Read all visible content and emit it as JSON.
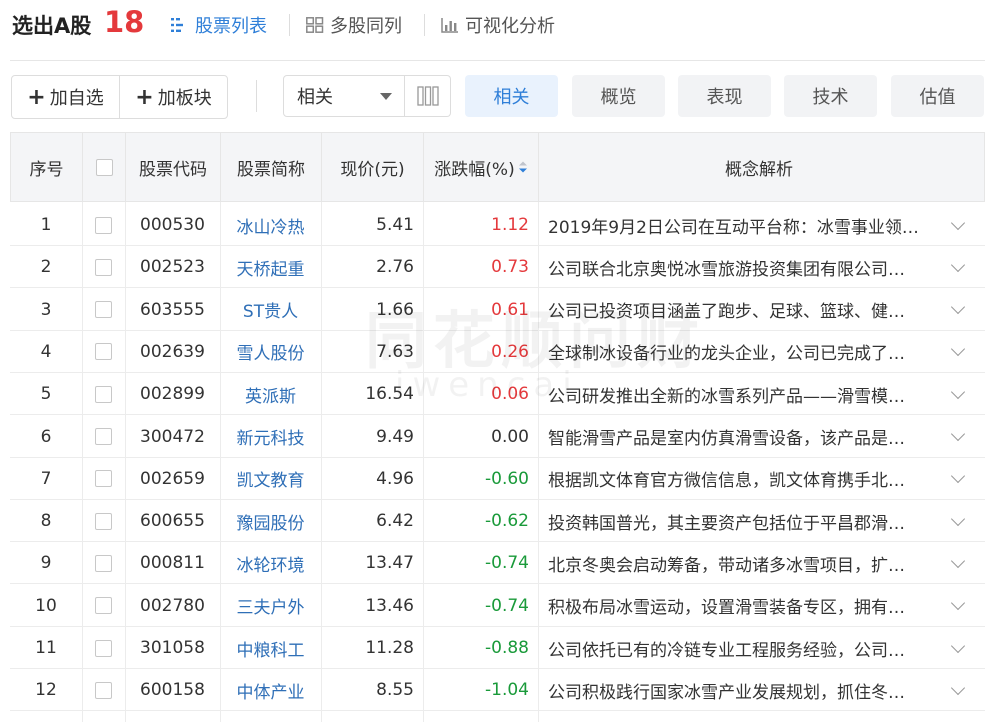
{
  "header": {
    "title": "选出A股",
    "count": "18",
    "tabs": [
      {
        "label": "股票列表",
        "icon": "list-icon",
        "active": true
      },
      {
        "label": "多股同列",
        "icon": "grid-icon",
        "active": false
      },
      {
        "label": "可视化分析",
        "icon": "bar-chart-icon",
        "active": false
      }
    ]
  },
  "toolbar": {
    "add_watchlist": "加自选",
    "add_block": "加板块",
    "sort_select": "相关",
    "filters": [
      "相关",
      "概览",
      "表现",
      "技术",
      "估值"
    ],
    "active_filter": "相关"
  },
  "colors": {
    "accent": "#2f7fd8",
    "up": "#e4393c",
    "down": "#1a9a3a"
  },
  "table": {
    "columns": [
      "序号",
      "股票代码",
      "股票简称",
      "现价(元)",
      "涨跌幅(%)",
      "概念解析"
    ],
    "rows": [
      {
        "no": "1",
        "code": "000530",
        "name": "冰山冷热",
        "price": "5.41",
        "change": "1.12",
        "dir": "up",
        "concept": "2019年9月2日公司在互动平台称：冰雪事业领…"
      },
      {
        "no": "2",
        "code": "002523",
        "name": "天桥起重",
        "price": "2.76",
        "change": "0.73",
        "dir": "up",
        "concept": "公司联合北京奥悦冰雪旅游投资集团有限公司…"
      },
      {
        "no": "3",
        "code": "603555",
        "name": "ST贵人",
        "price": "1.66",
        "change": "0.61",
        "dir": "up",
        "concept": "公司已投资项目涵盖了跑步、足球、篮球、健…"
      },
      {
        "no": "4",
        "code": "002639",
        "name": "雪人股份",
        "price": "7.63",
        "change": "0.26",
        "dir": "up",
        "concept": "全球制冰设备行业的龙头企业，公司已完成了…"
      },
      {
        "no": "5",
        "code": "002899",
        "name": "英派斯",
        "price": "16.54",
        "change": "0.06",
        "dir": "up",
        "concept": "公司研发推出全新的冰雪系列产品——滑雪模…"
      },
      {
        "no": "6",
        "code": "300472",
        "name": "新元科技",
        "price": "9.49",
        "change": "0.00",
        "dir": "flat",
        "concept": "智能滑雪产品是室内仿真滑雪设备，该产品是…"
      },
      {
        "no": "7",
        "code": "002659",
        "name": "凯文教育",
        "price": "4.96",
        "change": "-0.60",
        "dir": "down",
        "concept": "根据凯文体育官方微信信息，凯文体育携手北…"
      },
      {
        "no": "8",
        "code": "600655",
        "name": "豫园股份",
        "price": "6.42",
        "change": "-0.62",
        "dir": "down",
        "concept": "投资韩国普光，其主要资产包括位于平昌郡滑…"
      },
      {
        "no": "9",
        "code": "000811",
        "name": "冰轮环境",
        "price": "13.47",
        "change": "-0.74",
        "dir": "down",
        "concept": "北京冬奥会启动筹备，带动诸多冰雪项目，扩…"
      },
      {
        "no": "10",
        "code": "002780",
        "name": "三夫户外",
        "price": "13.46",
        "change": "-0.74",
        "dir": "down",
        "concept": "积极布局冰雪运动，设置滑雪装备专区，拥有…"
      },
      {
        "no": "11",
        "code": "301058",
        "name": "中粮科工",
        "price": "11.28",
        "change": "-0.88",
        "dir": "down",
        "concept": "公司依托已有的冷链专业工程服务经验，公司…"
      },
      {
        "no": "12",
        "code": "600158",
        "name": "中体产业",
        "price": "8.55",
        "change": "-1.04",
        "dir": "down",
        "concept": "公司积极践行国家冰雪产业发展规划，抓住冬…"
      }
    ]
  },
  "watermark": {
    "line1": "同花顺问财",
    "line2": "iwencai"
  }
}
